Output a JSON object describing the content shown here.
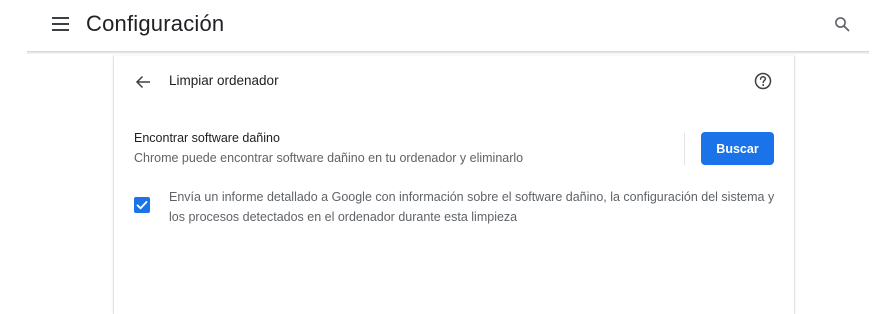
{
  "header": {
    "title": "Configuración",
    "menu_icon": "hamburger-menu-icon",
    "search_icon": "search-icon"
  },
  "subpage": {
    "title": "Limpiar ordenador",
    "back_icon": "arrow-back-icon",
    "help_icon": "help-circle-icon"
  },
  "cleanup": {
    "title": "Encontrar software dañino",
    "description": "Chrome puede encontrar software dañino en tu ordenador y eliminarlo",
    "button_label": "Buscar",
    "report_checkbox": {
      "checked": true,
      "label": "Envía un informe detallado a Google con información sobre el software dañino, la configuración del sistema y los procesos detectados en el ordenador durante esta limpieza"
    }
  },
  "colors": {
    "accent": "#1a73e8",
    "text_primary": "#202124",
    "text_secondary": "#5f6368"
  }
}
